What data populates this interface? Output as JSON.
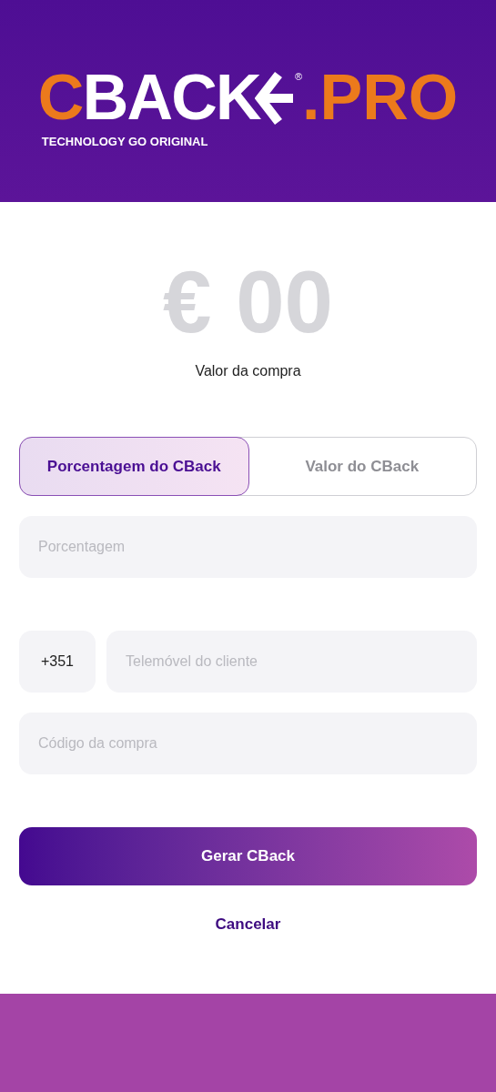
{
  "logo": {
    "accent": "C",
    "word": "BACK",
    "registered": "®",
    "suffix": ".PRO",
    "tagline": "TECHNOLOGY GO ORIGINAL"
  },
  "amount": {
    "value": "€ 00",
    "label": "Valor da compra"
  },
  "tabs": [
    {
      "label": "Porcentagem do CBack",
      "selected": true
    },
    {
      "label": "Valor do CBack",
      "selected": false
    }
  ],
  "percentage_field": {
    "placeholder": "Porcentagem"
  },
  "phone": {
    "prefix": "+351",
    "placeholder": "Telemóvel do cliente"
  },
  "code_field": {
    "placeholder": "Código da compra"
  },
  "primary_button": "Gerar CBack",
  "cancel_link": "Cancelar"
}
